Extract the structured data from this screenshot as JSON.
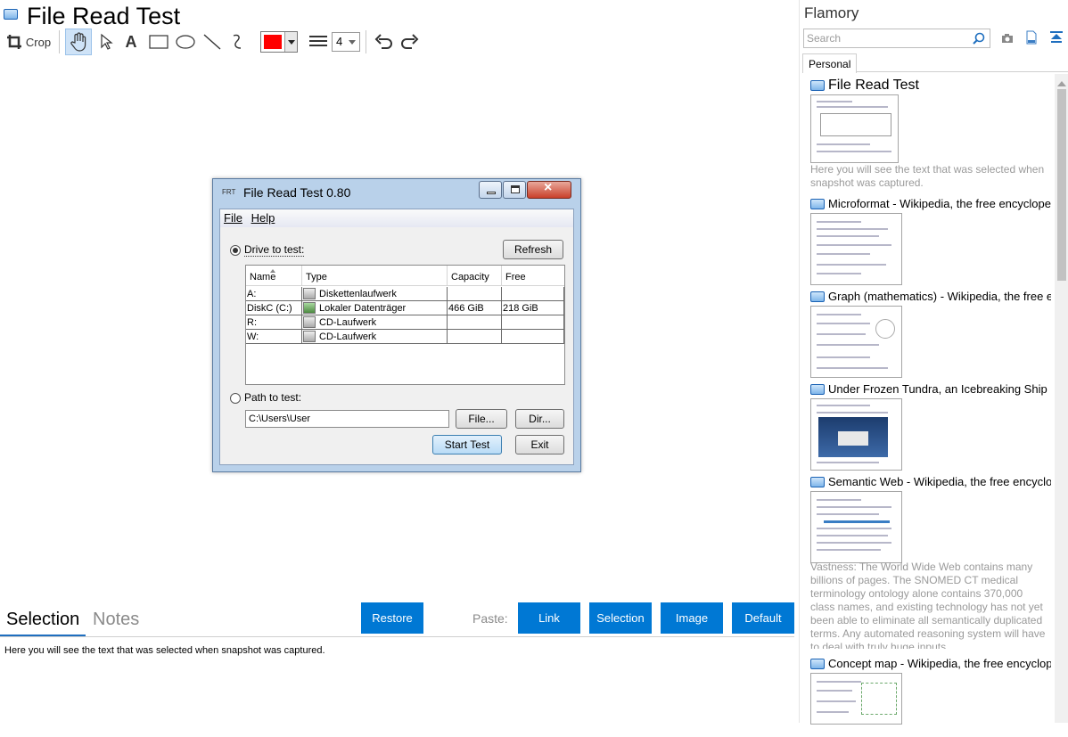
{
  "app": {
    "title": "File Read Test"
  },
  "toolbar": {
    "crop_label": "Crop",
    "line_width": "4",
    "color": "#ff0000"
  },
  "screenshot": {
    "window_title": "File Read Test 0.80",
    "icon_label": "FRT",
    "menu": [
      "File",
      "Help"
    ],
    "drive_label": "Drive to test:",
    "refresh_label": "Refresh",
    "columns": [
      "Name",
      "Type",
      "Capacity",
      "Free"
    ],
    "rows": [
      [
        "A:",
        "Diskettenlaufwerk",
        "",
        ""
      ],
      [
        "DiskC (C:)",
        "Lokaler Datenträger",
        "466 GiB",
        "218 GiB"
      ],
      [
        "R:",
        "CD-Laufwerk",
        "",
        ""
      ],
      [
        "W:",
        "CD-Laufwerk",
        "",
        ""
      ]
    ],
    "path_label": "Path to test:",
    "path_value": "C:\\Users\\User",
    "file_button": "File...",
    "dir_button": "Dir...",
    "start_button": "Start Test",
    "exit_button": "Exit"
  },
  "bottom": {
    "tab_selection": "Selection",
    "tab_notes": "Notes",
    "restore": "Restore",
    "paste_label": "Paste:",
    "link": "Link",
    "selection": "Selection",
    "image": "Image",
    "default": "Default",
    "selected_text": "Here you will see the text that was selected when snapshot was captured."
  },
  "sidebar": {
    "brand": "Flamory",
    "search_placeholder": "Search",
    "tab_personal": "Personal",
    "items": [
      {
        "title": "File Read Test",
        "desc": "Here you will see the text that was selected when snapshot was captured."
      },
      {
        "title": "Microformat - Wikipedia, the free encyclopedia",
        "desc": ""
      },
      {
        "title": "Graph (mathematics) - Wikipedia, the free encyclopedia",
        "desc": ""
      },
      {
        "title": "Under Frozen Tundra, an Icebreaking Ship Uncovers",
        "desc": ""
      },
      {
        "title": "Semantic Web - Wikipedia, the free encyclopedia",
        "desc": "Vastness: The World Wide Web contains many billions of pages. The SNOMED CT medical terminology ontology alone contains 370,000 class names, and existing technology has not yet been able to eliminate all semantically duplicated terms. Any automated reasoning system will have to deal with truly huge inputs."
      },
      {
        "title": "Concept map - Wikipedia, the free encyclopedia",
        "desc": ""
      }
    ]
  }
}
